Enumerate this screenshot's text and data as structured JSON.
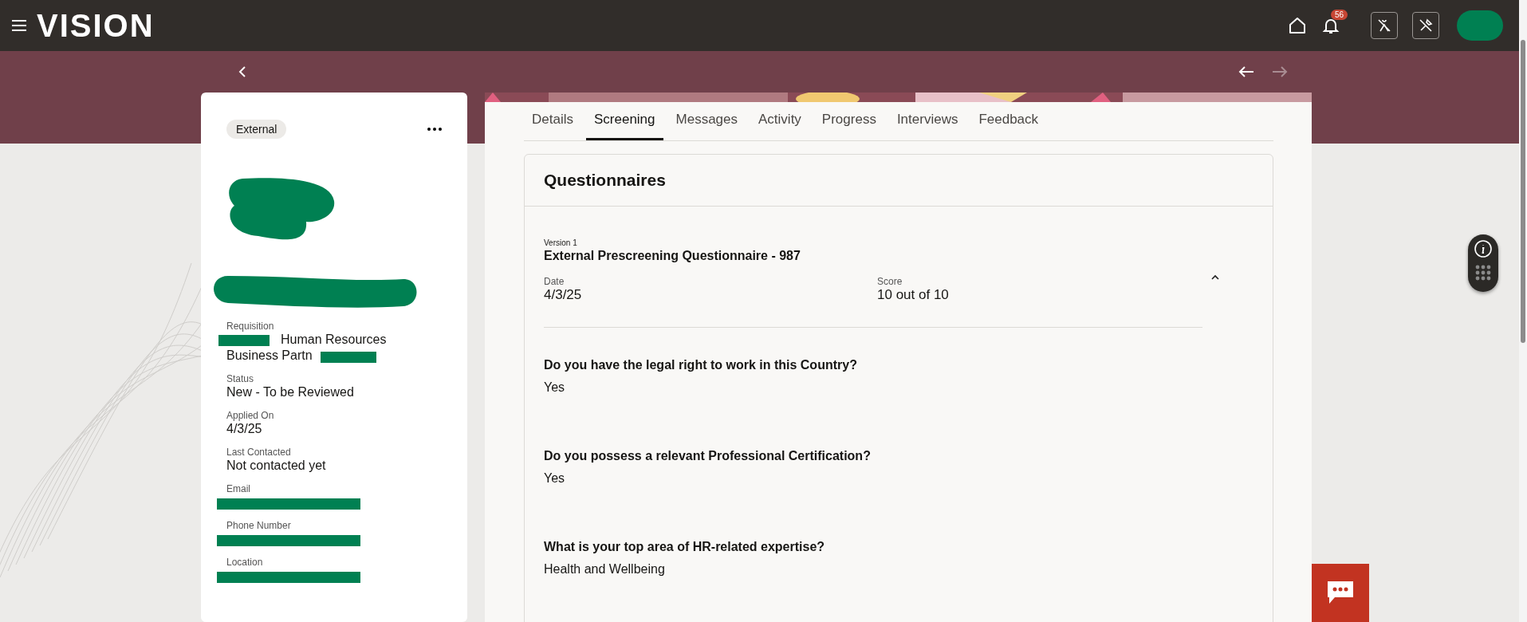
{
  "topbar": {
    "logo": "VISION",
    "notifications": {
      "count": "56"
    }
  },
  "nav": {
    "previous": {
      "disabled": false
    },
    "next": {
      "disabled": true
    }
  },
  "candidate": {
    "tag": "External",
    "fields": [
      {
        "label": "Requisition",
        "lines": [
          "Human Resources",
          "Business Partn"
        ],
        "redacted": true
      },
      {
        "label": "Status",
        "lines": [
          "New - To be Reviewed"
        ],
        "redacted": false
      },
      {
        "label": "Applied On",
        "lines": [
          "4/3/25"
        ],
        "redacted": false
      },
      {
        "label": "Last Contacted",
        "lines": [
          "Not contacted yet"
        ],
        "redacted": false
      },
      {
        "label": "Email",
        "redacted": true
      },
      {
        "label": "Phone Number",
        "redacted": true
      },
      {
        "label": "Location",
        "redacted": true
      }
    ]
  },
  "tabs": [
    {
      "label": "Details",
      "selected": false
    },
    {
      "label": "Screening",
      "selected": true
    },
    {
      "label": "Messages",
      "selected": false
    },
    {
      "label": "Activity",
      "selected": false
    },
    {
      "label": "Progress",
      "selected": false
    },
    {
      "label": "Interviews",
      "selected": false
    },
    {
      "label": "Feedback",
      "selected": false
    }
  ],
  "questionnaires": {
    "title": "Questionnaires",
    "version": "Version 1",
    "name": "External Prescreening Questionnaire - 987",
    "expanded": true,
    "date_label": "Date",
    "date": "4/3/25",
    "score_label": "Score",
    "score": "10 out of 10",
    "questions": [
      {
        "question": "Do you have the legal right to work in this Country?",
        "answer": "Yes"
      },
      {
        "question": "Do you possess a relevant Professional Certification?",
        "answer": "Yes"
      },
      {
        "question": "What is your top area of HR-related expertise?",
        "answer": "Health and Wellbeing"
      }
    ]
  }
}
